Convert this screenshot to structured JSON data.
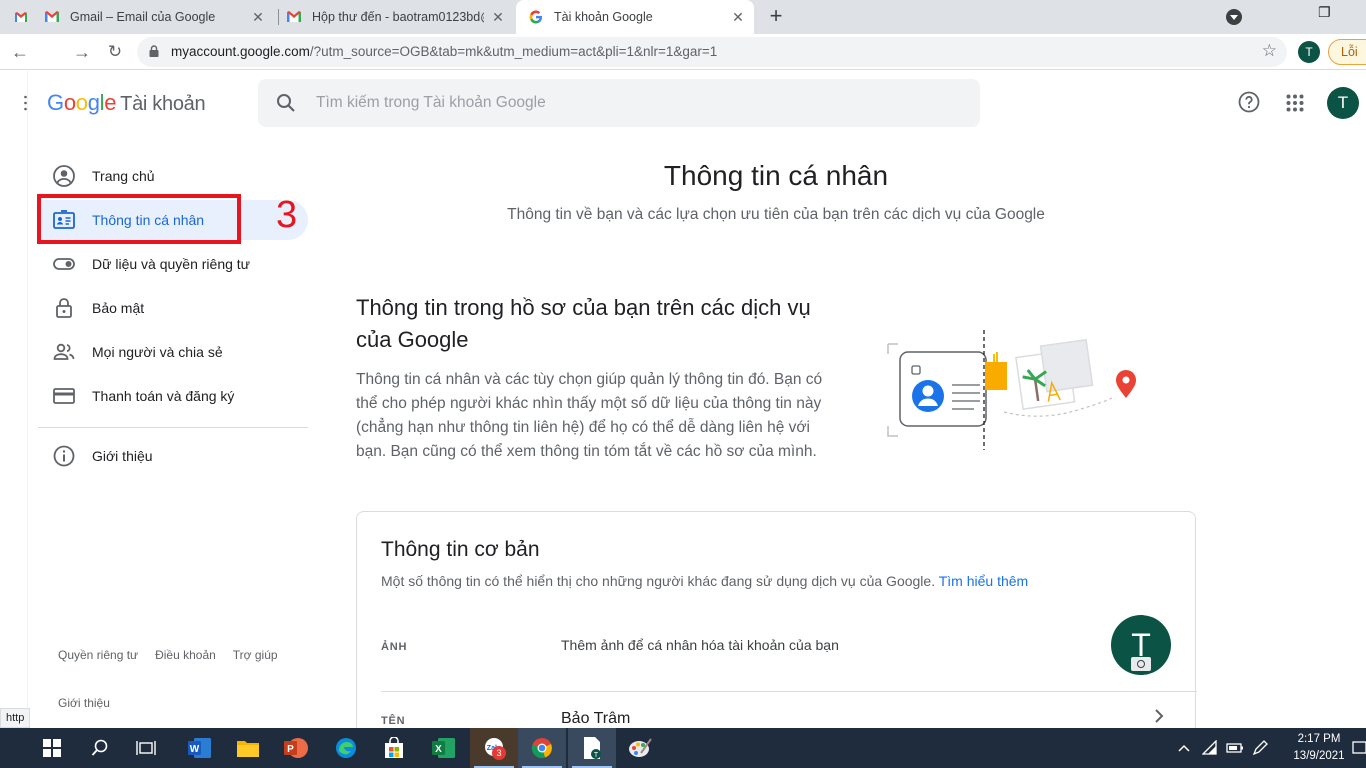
{
  "browser": {
    "tabs": [
      {
        "title": "Gmail – Email của Google",
        "favicon": "gmail-icon"
      },
      {
        "title": "Hộp thư đến - baotram0123bd@",
        "favicon": "gmail-icon"
      },
      {
        "title": "Tài khoản Google",
        "favicon": "google-g-icon",
        "active": true
      }
    ],
    "url_host": "myaccount.google.com",
    "url_path": "/?utm_source=OGB&tab=mk&utm_medium=act&pli=1&nlr=1&gar=1",
    "profile_initial": "T",
    "error_label": "Lỗi"
  },
  "header": {
    "logo_letters": [
      "G",
      "o",
      "o",
      "g",
      "l",
      "e"
    ],
    "product": "Tài khoản",
    "search_placeholder": "Tìm kiếm trong Tài khoản Google",
    "avatar_initial": "T"
  },
  "sidebar": {
    "items": [
      {
        "label": "Trang chủ",
        "icon": "account-circle-icon"
      },
      {
        "label": "Thông tin cá nhân",
        "icon": "id-card-icon",
        "active": true
      },
      {
        "label": "Dữ liệu và quyền riêng tư",
        "icon": "toggle-icon"
      },
      {
        "label": "Bảo mật",
        "icon": "lock-icon"
      },
      {
        "label": "Mọi người và chia sẻ",
        "icon": "people-icon"
      },
      {
        "label": "Thanh toán và đăng ký",
        "icon": "credit-card-icon"
      },
      {
        "label": "Giới thiệu",
        "icon": "info-icon"
      }
    ],
    "annotation_number": "3",
    "footer_links": [
      "Quyền riêng tư",
      "Điều khoản",
      "Trợ giúp"
    ],
    "footer_about": "Giới thiệu",
    "status_tip": "http"
  },
  "main": {
    "title": "Thông tin cá nhân",
    "subtitle": "Thông tin về bạn và các lựa chọn ưu tiên của bạn trên các dịch vụ của Google",
    "section_title": "Thông tin trong hồ sơ của bạn trên các dịch vụ của Google",
    "section_desc": "Thông tin cá nhân và các tùy chọn giúp quản lý thông tin đó. Bạn có thể cho phép người khác nhìn thấy một số dữ liệu của thông tin này (chẳng hạn như thông tin liên hệ) để họ có thể dễ dàng liên hệ với bạn. Bạn cũng có thể xem thông tin tóm tắt về các hồ sơ của mình.",
    "card": {
      "title": "Thông tin cơ bản",
      "desc": "Một số thông tin có thể hiển thị cho những người khác đang sử dụng dịch vụ của Google.",
      "learn_more": "Tìm hiểu thêm",
      "rows": [
        {
          "label": "ẢNH",
          "value": "Thêm ảnh để cá nhân hóa tài khoản của bạn"
        },
        {
          "label": "TÊN",
          "value": "Bảo Trâm"
        }
      ],
      "photo_initial": "T"
    }
  },
  "taskbar": {
    "time": "2:17 PM",
    "date": "13/9/2021",
    "zalo_badge": "3"
  },
  "colors": {
    "accent": "#1a73e8",
    "active_nav_bg": "#e8f0fe",
    "avatar_bg": "#0b5345",
    "annotation_red": "#e8141e"
  }
}
